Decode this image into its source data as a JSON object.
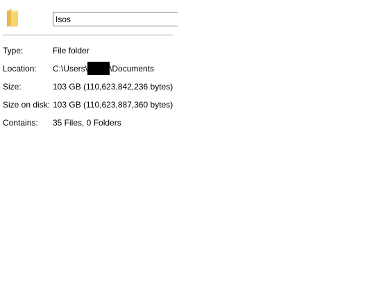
{
  "header": {
    "icon": "folder-icon",
    "name_value": "Isos"
  },
  "properties": [
    {
      "label": "Type:",
      "value": "File folder"
    },
    {
      "label": "Location:",
      "value_prefix": "C:\\Users\\",
      "value_suffix": "\\Documents"
    },
    {
      "label": "Size:",
      "value": "103 GB (110,623,842,236 bytes)"
    },
    {
      "label": "Size on disk:",
      "value": "103 GB (110,623,887,360 bytes)"
    },
    {
      "label": "Contains:",
      "value": "35 Files, 0 Folders"
    }
  ],
  "colors": {
    "folder_front": "#f7d46e",
    "folder_back": "#e8b84a",
    "separator": "#a0a0a0",
    "field_border": "#7a7a7a",
    "redaction": "#000000"
  }
}
